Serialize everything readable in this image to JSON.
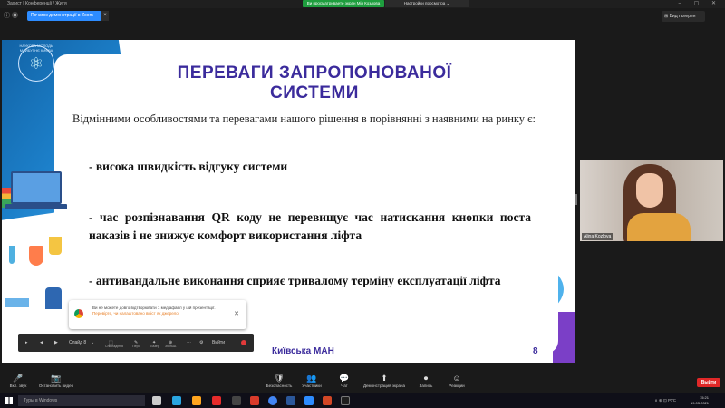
{
  "window": {
    "app_title": "Захист I Конференції / Житя",
    "green_pill": "Ви просматриваете экран Мія Козлова",
    "view_options": "Настройки просмотра ⌄",
    "controls": "–  ▢  ✕"
  },
  "tabbar": {
    "share_pill": "Початок демонстрації в Zoom",
    "gallery_view": "⊞ Вид галерея"
  },
  "slide": {
    "logo_caption": "НАУКОВА МОЛОДЬ МАЙБУТНЄ КИЄВА",
    "title": "ПЕРЕВАГИ ЗАПРОПОНОВАНОЇ СИСТЕМИ",
    "intro": "Відмінними особливостями та перевагами нашого рішення в порівнянні з наявними на ринку є:",
    "bullets": [
      "- висока швидкість відгуку системи",
      "- час розпізнавання QR коду не перевищує час натискання кнопки поста наказів і не знижує комфорт використання ліфта",
      "- антивандальне виконання сприяє тривалому терміну експлуатації ліфта"
    ],
    "footer": "Київська МАН",
    "page_number": "8"
  },
  "toast": {
    "message": "Ви не можете довго відтворювати 1 медіафайл у цій презентації.",
    "link": "Перевірте, чи налаштовано вміст як джерело."
  },
  "presentation_bar": {
    "slide_label": "Слайд 8",
    "items": [
      "Співпадіння",
      "Перо",
      "Лазер",
      "Збільш."
    ],
    "exit_label": "Вийти"
  },
  "video": {
    "participant_name": "Alina Kozlova"
  },
  "meeting_toolbar": {
    "buttons": [
      {
        "icon": "🎤",
        "label": "Вкл. звук"
      },
      {
        "icon": "📷",
        "label": "Остановить видео"
      },
      {
        "icon": "🛡",
        "label": "Безопасность"
      },
      {
        "icon": "👥",
        "label": "Участники"
      },
      {
        "icon": "💬",
        "label": "Чат"
      },
      {
        "icon": "⬆",
        "label": "Демонстрация экрана"
      },
      {
        "icon": "⏺",
        "label": "Запись"
      },
      {
        "icon": "☺",
        "label": "Реакции"
      }
    ],
    "leave": "Выйти"
  },
  "taskbar": {
    "search_placeholder": "Туры в Windows",
    "time": "15:21",
    "date": "19.03.2021",
    "tray": "∧ ⊕ ⊡ РУС"
  },
  "colors": {
    "zoom_blue": "#2d8cff",
    "share_green": "#1e9e3e",
    "leave_red": "#e02828",
    "slide_title": "#3b2b9c"
  }
}
